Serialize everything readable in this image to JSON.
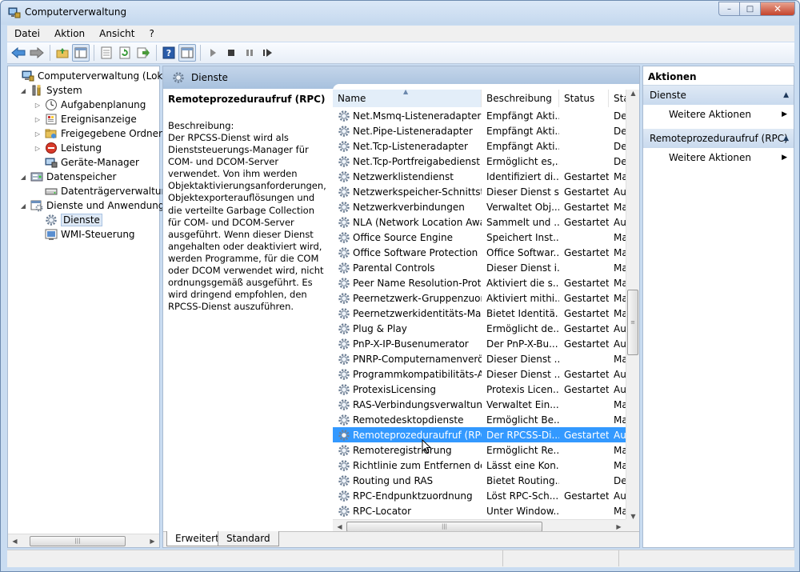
{
  "window": {
    "title": "Computerverwaltung",
    "controls": {
      "minimize": "–",
      "maximize": "□",
      "close": "✕"
    }
  },
  "menu": [
    "Datei",
    "Aktion",
    "Ansicht",
    "?"
  ],
  "tree": {
    "items": [
      {
        "label": "Computerverwaltung (Lokal)",
        "icon": "computer-icon",
        "level": 0,
        "expander": ""
      },
      {
        "label": "System",
        "icon": "tools-icon",
        "level": 1,
        "expander": "◢"
      },
      {
        "label": "Aufgabenplanung",
        "icon": "clock-icon",
        "level": 2,
        "expander": "▷"
      },
      {
        "label": "Ereignisanzeige",
        "icon": "event-viewer-icon",
        "level": 2,
        "expander": "▷"
      },
      {
        "label": "Freigegebene Ordner",
        "icon": "shared-folder-icon",
        "level": 2,
        "expander": "▷"
      },
      {
        "label": "Leistung",
        "icon": "no-entry-icon",
        "level": 2,
        "expander": "▷"
      },
      {
        "label": "Geräte-Manager",
        "icon": "device-manager-icon",
        "level": 2,
        "expander": ""
      },
      {
        "label": "Datenspeicher",
        "icon": "storage-icon",
        "level": 1,
        "expander": "◢"
      },
      {
        "label": "Datenträgerverwaltung",
        "icon": "disk-icon",
        "level": 2,
        "expander": ""
      },
      {
        "label": "Dienste und Anwendungen",
        "icon": "services-apps-icon",
        "level": 1,
        "expander": "◢"
      },
      {
        "label": "Dienste",
        "icon": "gear-icon",
        "level": 2,
        "expander": "",
        "selected": true
      },
      {
        "label": "WMI-Steuerung",
        "icon": "wmi-icon",
        "level": 2,
        "expander": ""
      }
    ]
  },
  "center": {
    "header": "Dienste",
    "selected_service": "Remoteprozeduraufruf (RPC)",
    "description_label": "Beschreibung:",
    "description_text": "Der RPCSS-Dienst wird als Dienststeuerungs-Manager für COM- und DCOM-Server verwendet. Von ihm werden Objektaktivierungsanforderungen, Objektexporterauflösungen und die verteilte Garbage Collection für COM- und DCOM-Server ausgeführt. Wenn dieser Dienst angehalten oder deaktiviert wird, werden Programme, für die COM oder DCOM verwendet wird, nicht ordnungsgemäß ausgeführt. Es wird dringend empfohlen, den RPCSS-Dienst auszuführen.",
    "columns": [
      "Name",
      "Beschreibung",
      "Status",
      "Sta"
    ],
    "services": [
      {
        "name": "Net.Msmq-Listeneradapter",
        "desc": "Empfängt Akti...",
        "status": "",
        "start": "De"
      },
      {
        "name": "Net.Pipe-Listeneradapter",
        "desc": "Empfängt Akti...",
        "status": "",
        "start": "De"
      },
      {
        "name": "Net.Tcp-Listeneradapter",
        "desc": "Empfängt Akti...",
        "status": "",
        "start": "De"
      },
      {
        "name": "Net.Tcp-Portfreigabedienst",
        "desc": "Ermöglicht es,...",
        "status": "",
        "start": "De"
      },
      {
        "name": "Netzwerklistendienst",
        "desc": "Identifiziert di...",
        "status": "Gestartet",
        "start": "Ma"
      },
      {
        "name": "Netzwerkspeicher-Schnittstel...",
        "desc": "Dieser Dienst s...",
        "status": "Gestartet",
        "start": "Au"
      },
      {
        "name": "Netzwerkverbindungen",
        "desc": "Verwaltet Obj...",
        "status": "Gestartet",
        "start": "Ma"
      },
      {
        "name": "NLA (Network Location Awa...",
        "desc": "Sammelt und ...",
        "status": "Gestartet",
        "start": "Au"
      },
      {
        "name": "Office  Source Engine",
        "desc": "Speichert Inst...",
        "status": "",
        "start": "Ma"
      },
      {
        "name": "Office Software Protection Pl...",
        "desc": "Office Softwar...",
        "status": "Gestartet",
        "start": "Ma"
      },
      {
        "name": "Parental Controls",
        "desc": "Dieser Dienst i...",
        "status": "",
        "start": "Ma"
      },
      {
        "name": "Peer Name Resolution-Proto...",
        "desc": "Aktiviert die s...",
        "status": "Gestartet",
        "start": "Ma"
      },
      {
        "name": "Peernetzwerk-Gruppenzuord...",
        "desc": "Aktiviert mithi...",
        "status": "Gestartet",
        "start": "Ma"
      },
      {
        "name": "Peernetzwerkidentitäts-Man...",
        "desc": "Bietet Identitä...",
        "status": "Gestartet",
        "start": "Ma"
      },
      {
        "name": "Plug & Play",
        "desc": "Ermöglicht de...",
        "status": "Gestartet",
        "start": "Au"
      },
      {
        "name": "PnP-X-IP-Busenumerator",
        "desc": "Der PnP-X-Bu...",
        "status": "Gestartet",
        "start": "Au"
      },
      {
        "name": "PNRP-Computernamenveröf...",
        "desc": "Dieser Dienst ...",
        "status": "",
        "start": "Ma"
      },
      {
        "name": "Programmkompatibilitäts-A...",
        "desc": "Dieser Dienst ...",
        "status": "Gestartet",
        "start": "Au"
      },
      {
        "name": "ProtexisLicensing",
        "desc": "Protexis Licen...",
        "status": "Gestartet",
        "start": "Au"
      },
      {
        "name": "RAS-Verbindungsverwaltung",
        "desc": "Verwaltet Ein...",
        "status": "",
        "start": "Ma"
      },
      {
        "name": "Remotedesktopdienste",
        "desc": "Ermöglicht Be...",
        "status": "",
        "start": "Ma"
      },
      {
        "name": "Remoteprozeduraufruf (RPC)",
        "desc": "Der RPCSS-Di...",
        "status": "Gestartet",
        "start": "Au",
        "selected": true
      },
      {
        "name": "Remoteregistrierung",
        "desc": "Ermöglicht Re...",
        "status": "",
        "start": "Ma"
      },
      {
        "name": "Richtlinie zum Entfernen der ...",
        "desc": "Lässt eine Kon...",
        "status": "",
        "start": "Ma"
      },
      {
        "name": "Routing und RAS",
        "desc": "Bietet Routing...",
        "status": "",
        "start": "De"
      },
      {
        "name": "RPC-Endpunktzuordnung",
        "desc": "Löst RPC-Sch...",
        "status": "Gestartet",
        "start": "Au"
      },
      {
        "name": "RPC-Locator",
        "desc": "Unter Window...",
        "status": "",
        "start": "Ma"
      }
    ],
    "tabs": [
      "Erweitert",
      "Standard"
    ]
  },
  "actions": {
    "title": "Aktionen",
    "sections": [
      {
        "label": "Dienste",
        "item": "Weitere Aktionen"
      },
      {
        "label": "Remoteprozeduraufruf (RPC)",
        "item": "Weitere Aktionen"
      }
    ]
  },
  "colors": {
    "selection": "#3399ff",
    "header_gradient_top": "#c3d5ea",
    "frame": "#c9dcf1"
  }
}
